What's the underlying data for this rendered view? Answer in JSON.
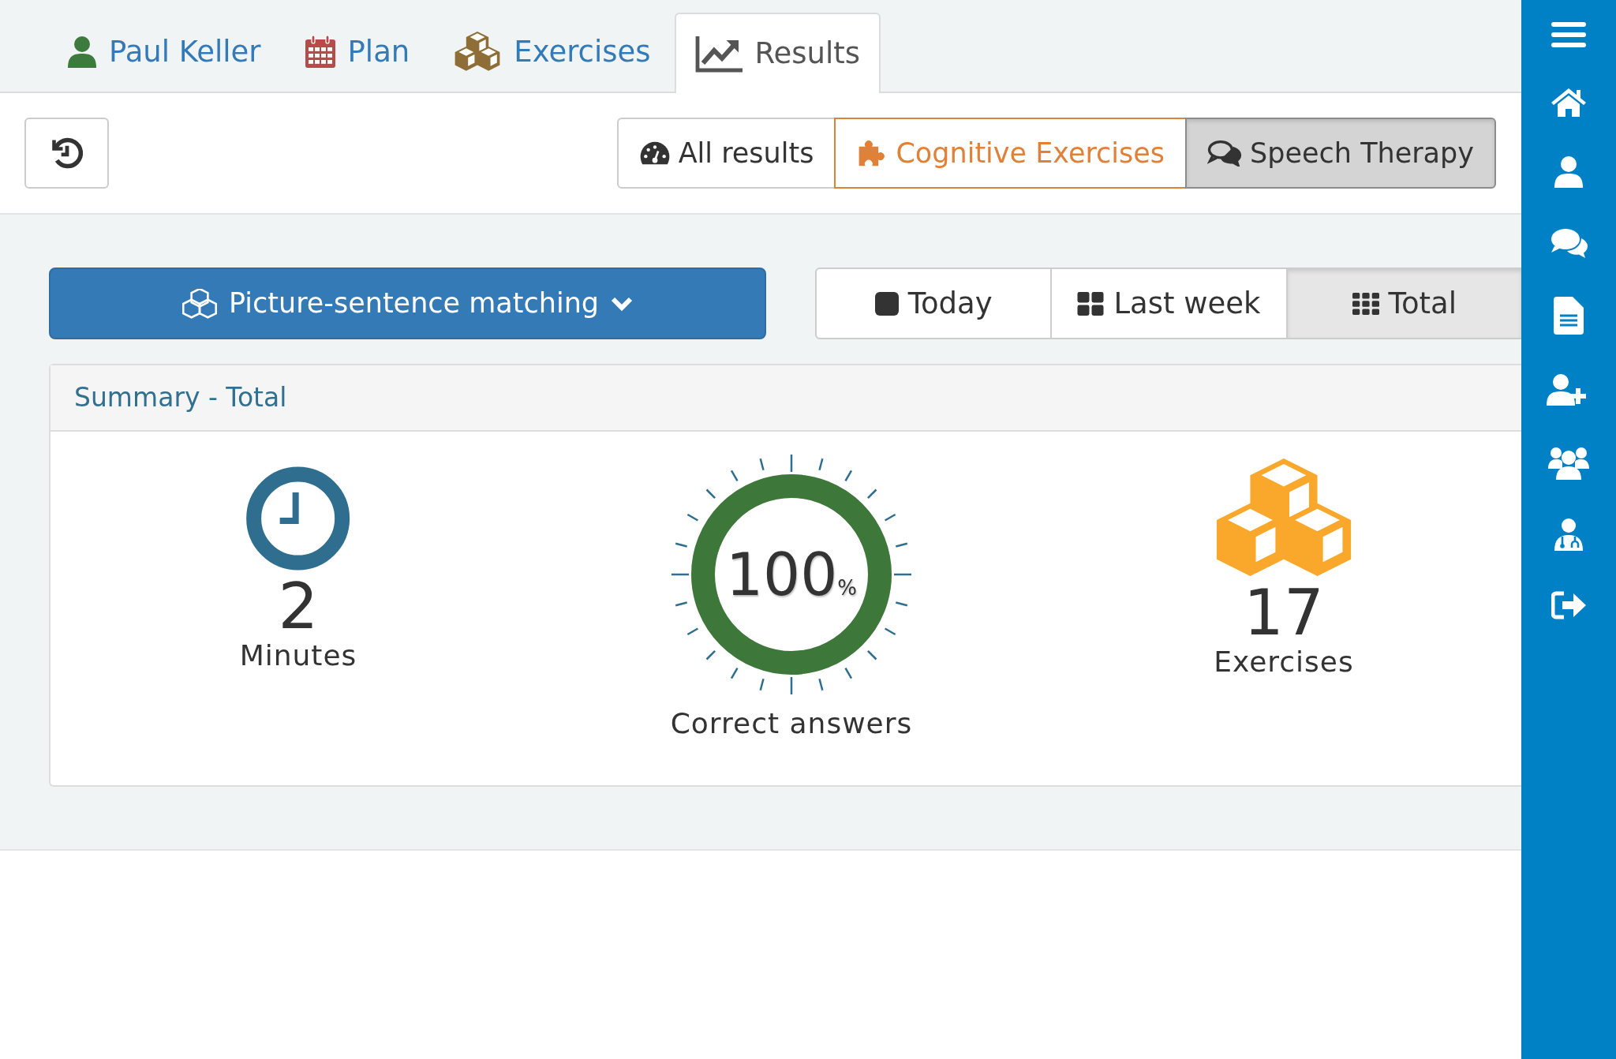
{
  "tabs": [
    {
      "label": "Paul Keller",
      "selected": false
    },
    {
      "label": "Plan",
      "selected": false
    },
    {
      "label": "Exercises",
      "selected": false
    },
    {
      "label": "Results",
      "selected": true
    }
  ],
  "categories": [
    {
      "label": "All results",
      "selected": false,
      "outlined": false,
      "color": "#333333"
    },
    {
      "label": "Cognitive Exercises",
      "selected": false,
      "outlined": true,
      "color": "#e0813a"
    },
    {
      "label": "Speech Therapy",
      "selected": true,
      "outlined": false,
      "color": "#333333"
    }
  ],
  "exercise_dropdown": {
    "label": "Picture-sentence matching"
  },
  "periods": [
    {
      "label": "Today",
      "selected": false
    },
    {
      "label": "Last week",
      "selected": false
    },
    {
      "label": "Total",
      "selected": true
    }
  ],
  "summary": {
    "title": "Summary - Total",
    "minutes": {
      "value": "2",
      "label": "Minutes"
    },
    "correct": {
      "value": "100",
      "unit": "%",
      "label": "Correct answers",
      "level": 1
    },
    "exercises": {
      "value": "17",
      "label": "Exercises"
    }
  }
}
